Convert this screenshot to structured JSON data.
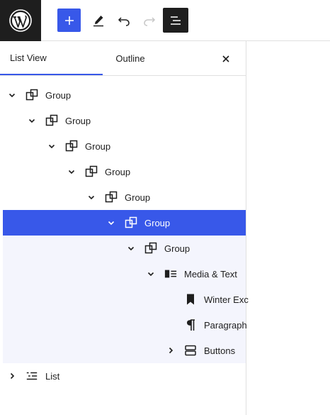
{
  "toolbar": {
    "logo_icon": "wordpress-logo",
    "add_icon": "plus-icon",
    "edit_icon": "pencil-icon",
    "undo_icon": "undo-icon",
    "redo_icon": "redo-icon",
    "list_view_icon": "list-view-icon"
  },
  "panel": {
    "tabs": [
      {
        "label": "List View",
        "active": true
      },
      {
        "label": "Outline",
        "active": false
      }
    ],
    "close_icon": "close-icon"
  },
  "tree": {
    "items": [
      {
        "label": "Group",
        "icon": "group-icon",
        "level": 0,
        "expanded": true
      },
      {
        "label": "Group",
        "icon": "group-icon",
        "level": 1,
        "expanded": true
      },
      {
        "label": "Group",
        "icon": "group-icon",
        "level": 2,
        "expanded": true
      },
      {
        "label": "Group",
        "icon": "group-icon",
        "level": 3,
        "expanded": true
      },
      {
        "label": "Group",
        "icon": "group-icon",
        "level": 4,
        "expanded": true
      },
      {
        "label": "Group",
        "icon": "group-icon",
        "level": 5,
        "expanded": true,
        "selected": true
      },
      {
        "label": "Group",
        "icon": "group-icon",
        "level": 6,
        "expanded": true
      },
      {
        "label": "Media & Text",
        "icon": "media-text-icon",
        "level": 7,
        "expanded": true
      },
      {
        "label": "Winter Exc",
        "icon": "bookmark-icon",
        "level": 8
      },
      {
        "label": "Paragraph",
        "icon": "paragraph-icon",
        "level": 8
      },
      {
        "label": "Buttons",
        "icon": "buttons-icon",
        "level": 8,
        "expanded": false
      },
      {
        "label": "List",
        "icon": "list-icon",
        "level": 0,
        "expanded": false
      }
    ]
  },
  "colors": {
    "accent": "#3858e9",
    "dark": "#1e1e1e",
    "selected_children_bg": "#f4f5fd"
  }
}
